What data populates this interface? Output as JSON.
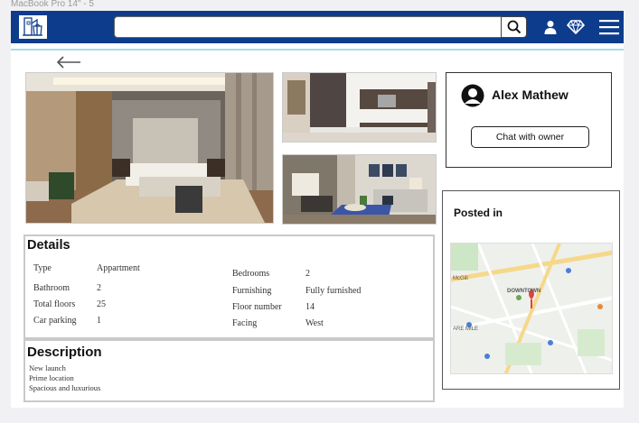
{
  "frame_label": "MacBook Pro 14\" - 5",
  "header": {
    "search_placeholder": "",
    "icons": [
      "logo-icon",
      "search-icon",
      "user-icon",
      "diamond-icon",
      "menu-icon"
    ],
    "brand_color": "#0d3c8c"
  },
  "gallery": {
    "photos": [
      "bedroom",
      "kitchen",
      "living-room"
    ]
  },
  "owner": {
    "name": "Alex Mathew",
    "chat_label": "Chat with owner"
  },
  "location": {
    "title": "Posted in",
    "map_labels": {
      "district": "DOWNTOWN",
      "area": "McGill",
      "mile": "ARE MILE"
    }
  },
  "details": {
    "title": "Details",
    "left": [
      {
        "label": "Type",
        "value": "Appartment"
      },
      {
        "label": "Bathroom",
        "value": "2"
      },
      {
        "label": "Total floors",
        "value": "25"
      },
      {
        "label": "Car parking",
        "value": "1"
      }
    ],
    "right": [
      {
        "label": "Bedrooms",
        "value": "2"
      },
      {
        "label": "Furnishing",
        "value": "Fully furnished"
      },
      {
        "label": "Floor number",
        "value": "14"
      },
      {
        "label": "Facing",
        "value": "West"
      }
    ]
  },
  "description": {
    "title": "Description",
    "lines": [
      "New launch",
      "Prime location",
      "Spacious and luxurious"
    ]
  }
}
